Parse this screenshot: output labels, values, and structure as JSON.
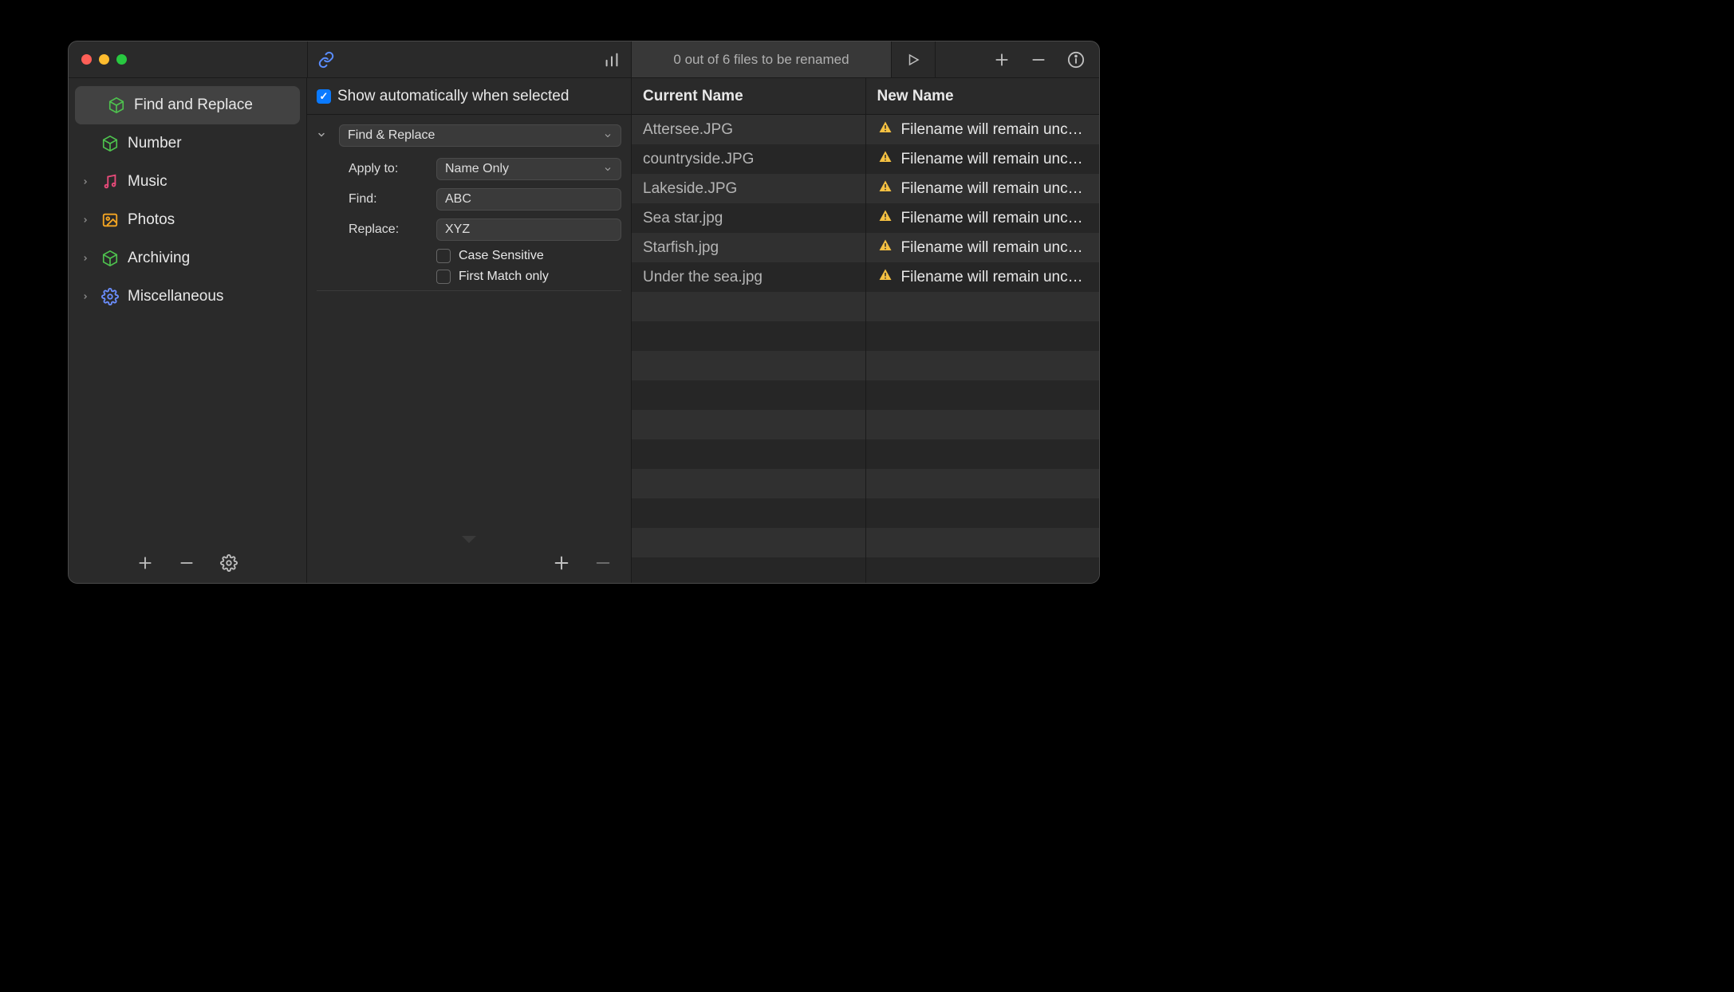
{
  "status": {
    "text": "0 out of 6 files to be renamed"
  },
  "sidebar": {
    "items": [
      {
        "label": "Find and Replace",
        "icon": "cube",
        "color": "#4ec24e",
        "expandable": false,
        "selected": true
      },
      {
        "label": "Number",
        "icon": "cube",
        "color": "#4ec24e",
        "expandable": false,
        "selected": false
      },
      {
        "label": "Music",
        "icon": "music",
        "color": "#e84a7a",
        "expandable": true,
        "selected": false
      },
      {
        "label": "Photos",
        "icon": "photo",
        "color": "#f5a623",
        "expandable": true,
        "selected": false
      },
      {
        "label": "Archiving",
        "icon": "cube",
        "color": "#4ec24e",
        "expandable": true,
        "selected": false
      },
      {
        "label": "Miscellaneous",
        "icon": "gear",
        "color": "#6b8eff",
        "expandable": true,
        "selected": false
      }
    ]
  },
  "config": {
    "show_auto_label": "Show automatically when selected",
    "show_auto_checked": true,
    "action_type": "Find & Replace",
    "apply_to_label": "Apply to:",
    "apply_to_value": "Name Only",
    "find_label": "Find:",
    "find_value": "ABC",
    "replace_label": "Replace:",
    "replace_value": "XYZ",
    "case_sensitive_label": "Case Sensitive",
    "case_sensitive_checked": false,
    "first_match_label": "First Match only",
    "first_match_checked": false
  },
  "table": {
    "col_current": "Current Name",
    "col_new": "New Name",
    "warning_text": "Filename will remain unc…",
    "rows": [
      {
        "current": "Attersee.JPG"
      },
      {
        "current": "countryside.JPG"
      },
      {
        "current": "Lakeside.JPG"
      },
      {
        "current": "Sea star.jpg"
      },
      {
        "current": "Starfish.jpg"
      },
      {
        "current": "Under the sea.jpg"
      }
    ],
    "empty_rows": 10
  }
}
